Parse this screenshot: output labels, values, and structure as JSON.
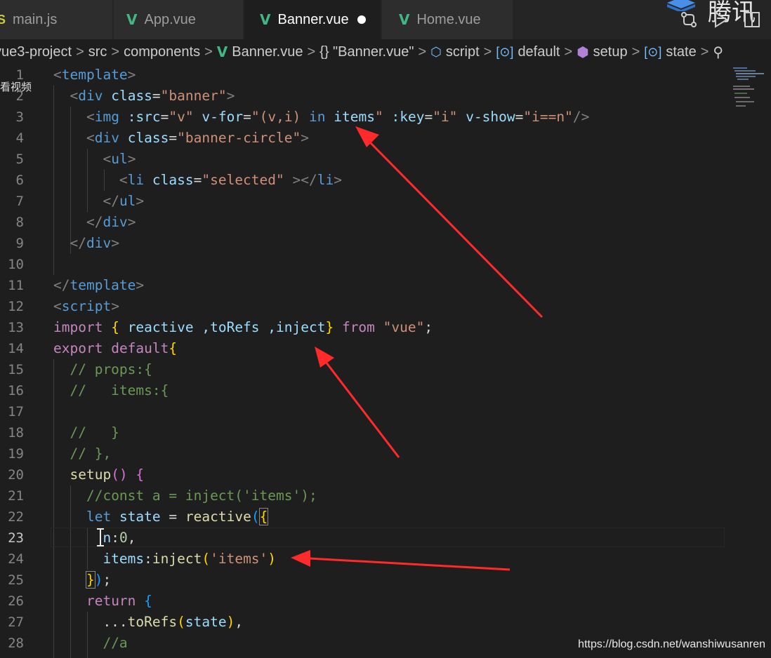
{
  "tabs": [
    {
      "label": "main.js",
      "icon": "js-icon"
    },
    {
      "label": "App.vue",
      "icon": "vue-icon"
    },
    {
      "label": "Banner.vue",
      "icon": "vue-icon",
      "active": true,
      "modified": true
    },
    {
      "label": "Home.vue",
      "icon": "vue-icon"
    }
  ],
  "logo_text": "腾讯",
  "breadcrumb": {
    "project": "vue3-project",
    "folder": "src",
    "subfolder": "components",
    "file": "Banner.vue",
    "block": "{} \"Banner.vue\"",
    "script": "script",
    "default": "default",
    "setup": "setup",
    "state": "state"
  },
  "overlay_text": "看视频",
  "current_line": 23,
  "lines": [
    {
      "n": "1"
    },
    {
      "n": "2"
    },
    {
      "n": "3"
    },
    {
      "n": "4"
    },
    {
      "n": "5"
    },
    {
      "n": "6"
    },
    {
      "n": "7"
    },
    {
      "n": "8"
    },
    {
      "n": "9"
    },
    {
      "n": "10"
    },
    {
      "n": "11"
    },
    {
      "n": "12"
    },
    {
      "n": "13"
    },
    {
      "n": "14"
    },
    {
      "n": "15"
    },
    {
      "n": "16"
    },
    {
      "n": "17"
    },
    {
      "n": "18"
    },
    {
      "n": "19"
    },
    {
      "n": "20"
    },
    {
      "n": "21"
    },
    {
      "n": "22"
    },
    {
      "n": "23"
    },
    {
      "n": "24"
    },
    {
      "n": "25"
    },
    {
      "n": "26"
    },
    {
      "n": "27"
    },
    {
      "n": "28"
    }
  ],
  "code": {
    "l1": {
      "tag": "template"
    },
    "l2": {
      "tag": "div",
      "attr": "class",
      "val": "\"banner\""
    },
    "l3": {
      "tag": "img",
      "a1": ":src",
      "v1": "\"v\"",
      "a2": "v-for",
      "v2a": "\"(v,i) ",
      "kw_in": "in",
      "v2b": " items",
      "v2c": "\"",
      "a3": ":key",
      "v3": "\"i\"",
      "a4": "v-show",
      "v4": "\"i==n\""
    },
    "l4": {
      "tag": "div",
      "attr": "class",
      "val": "\"banner-circle\""
    },
    "l5": {
      "tag": "ul"
    },
    "l6": {
      "tag": "li",
      "attr": "class",
      "val": "\"selected\"",
      "close": "li"
    },
    "l7": {
      "tag": "ul"
    },
    "l8": {
      "tag": "div"
    },
    "l9": {
      "tag": "div"
    },
    "l11": {
      "tag": "template"
    },
    "l12": {
      "tag": "script"
    },
    "l13": {
      "kw": "import",
      "names": " reactive ,toRefs ,inject",
      "from": "from",
      "mod": "\"vue\""
    },
    "l14": {
      "kw1": "export",
      "kw2": "default"
    },
    "l15": {
      "c": "// props:{"
    },
    "l16": {
      "c": "//   items:{"
    },
    "l18": {
      "c": "//   }"
    },
    "l19": {
      "c": "// },"
    },
    "l20": {
      "fn": "setup"
    },
    "l21": {
      "c": "//const a = inject('items');"
    },
    "l22": {
      "kw": "let",
      "var": "state",
      "fn": "reactive"
    },
    "l23": {
      "var": "n",
      "num": "0"
    },
    "l24": {
      "var": "items",
      "fn": "inject",
      "str": "'items'"
    },
    "l26": {
      "kw": "return"
    },
    "l27": {
      "fn": "toRefs",
      "var": "state"
    },
    "l28": {
      "c": "//a"
    }
  },
  "watermark": "https://blog.csdn.net/wanshiwusanren",
  "colors": {
    "vue_green": "#41b883",
    "arrow_red": "#ff2a2a",
    "editor_bg": "#1e1e1e"
  }
}
